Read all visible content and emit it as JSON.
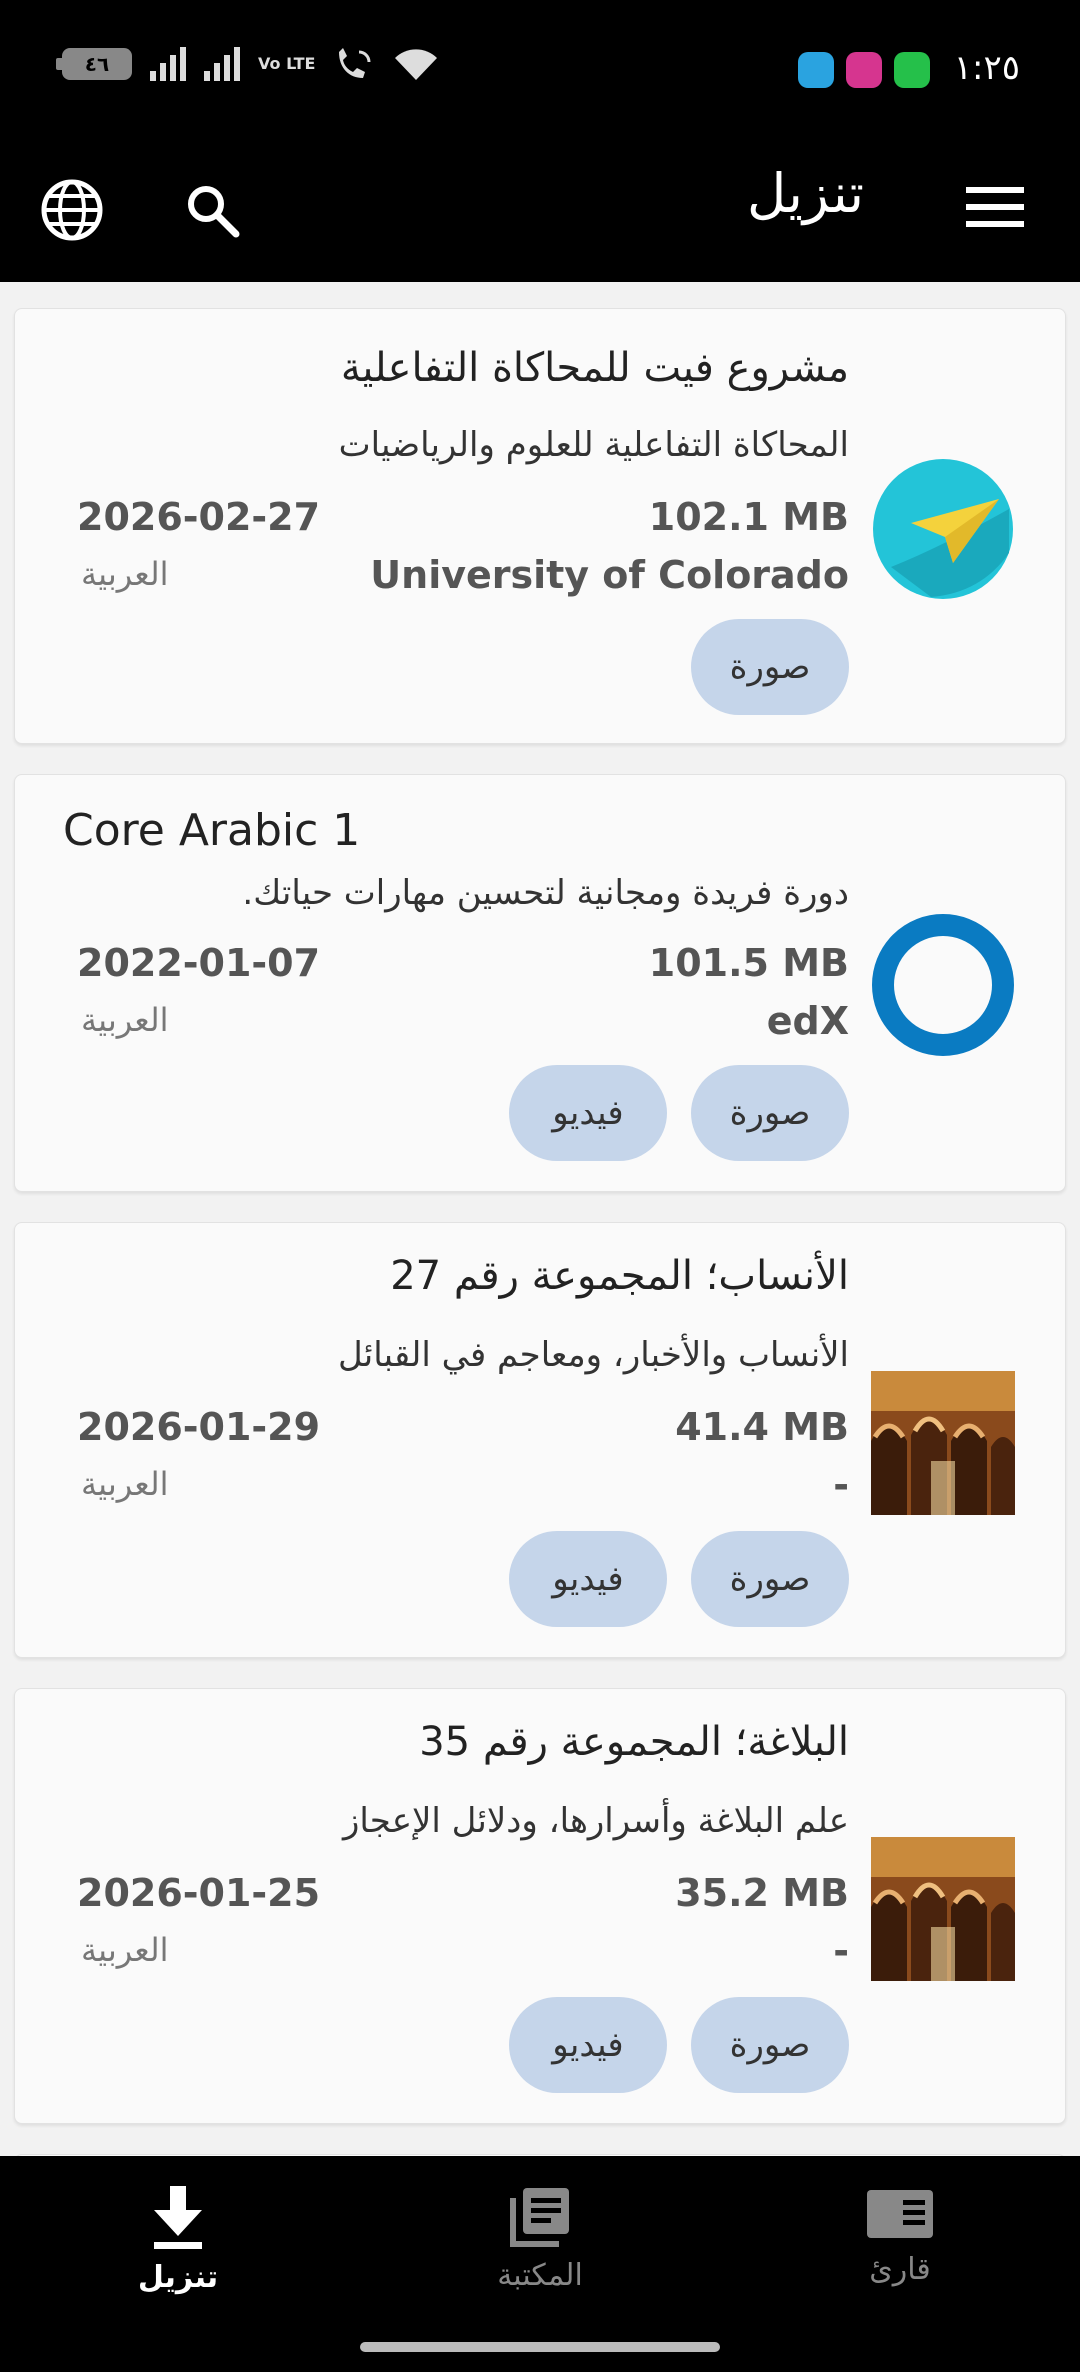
{
  "status_bar": {
    "time": "١:٢٥",
    "battery": "٤٦",
    "network_label": "Vo LTE"
  },
  "app_bar": {
    "title": "تنزيل",
    "menu_icon": "menu-icon",
    "search_icon": "search-icon",
    "language_icon": "globe-icon"
  },
  "cards": [
    {
      "title": "مشروع فيت للمحاكاة التفاعلية",
      "description": "المحاكاة التفاعلية للعلوم والرياضيات",
      "size": "102.1 MB",
      "date": "2026-02-27",
      "publisher": "University of Colorado",
      "language": "العربية",
      "chips": [
        "صورة"
      ],
      "thumb": "paper-plane-logo"
    },
    {
      "title": "Core Arabic 1",
      "description": "دورة فريدة ومجانية لتحسين مهارات حياتك.",
      "size": "101.5 MB",
      "date": "2022-01-07",
      "publisher": "edX",
      "language": "العربية",
      "chips": [
        "صورة",
        "فيديو"
      ],
      "thumb": "ring-logo"
    },
    {
      "title": "الأنساب؛ المجموعة رقم 27",
      "description": "الأنساب والأخبار، ومعاجم في القبائل",
      "size": "41.4 MB",
      "date": "2026-01-29",
      "publisher": "-",
      "language": "العربية",
      "chips": [
        "صورة",
        "فيديو"
      ],
      "thumb": "mosque-arches-photo"
    },
    {
      "title": "البلاغة؛ المجموعة رقم 35",
      "description": "علم البلاغة وأسرارها، ودلائل الإعجاز",
      "size": "35.2 MB",
      "date": "2026-01-25",
      "publisher": "-",
      "language": "العربية",
      "chips": [
        "صورة",
        "فيديو"
      ],
      "thumb": "mosque-arches-photo"
    }
  ],
  "bottom_nav": {
    "download": "تنزيل",
    "library": "المكتبة",
    "reader": "قارئ"
  },
  "colors": {
    "chip": "#c5d5ea",
    "bar": "#000000",
    "card": "#fafafa",
    "phet_teal": "#23c4d8",
    "edx_blue": "#0a7bc2"
  }
}
